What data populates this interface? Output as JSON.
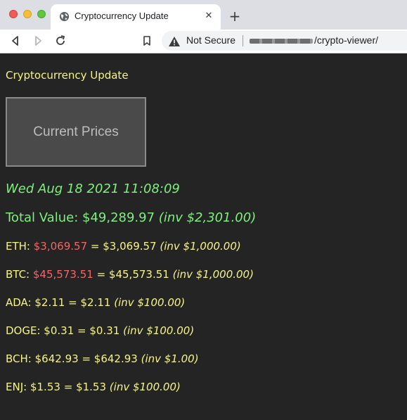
{
  "browser": {
    "tab_title": "Cryptocurrency Update",
    "address_security": "Not Secure",
    "address_path": "/crypto-viewer/"
  },
  "page": {
    "heading": "Cryptocurrency Update",
    "button_label": "Current Prices",
    "timestamp": "Wed Aug 18 2021 11:08:09",
    "total_label": "Total Value:",
    "total_value": "$49,289.97",
    "total_invested": "(inv $2,301.00)",
    "coins": [
      {
        "symbol": "ETH:",
        "price": "$3,069.57",
        "price_style": "red",
        "equals": "=",
        "value": "$3,069.57",
        "invested": "(inv $1,000.00)"
      },
      {
        "symbol": "BTC:",
        "price": "$45,573.51",
        "price_style": "red",
        "equals": "=",
        "value": "$45,573.51",
        "invested": "(inv $1,000.00)"
      },
      {
        "symbol": "ADA:",
        "price": "$2.11",
        "price_style": "normal",
        "equals": "=",
        "value": "$2.11",
        "invested": "(inv $100.00)"
      },
      {
        "symbol": "DOGE:",
        "price": "$0.31",
        "price_style": "normal",
        "equals": "=",
        "value": "$0.31",
        "invested": "(inv $100.00)"
      },
      {
        "symbol": "BCH:",
        "price": "$642.93",
        "price_style": "normal",
        "equals": "=",
        "value": "$642.93",
        "invested": "(inv $1.00)"
      },
      {
        "symbol": "ENJ:",
        "price": "$1.53",
        "price_style": "normal",
        "equals": "=",
        "value": "$1.53",
        "invested": "(inv $100.00)"
      }
    ]
  },
  "colors": {
    "background": "#242424",
    "text_yellow": "#f5f587",
    "text_green": "#7df07d",
    "price_red": "#f06868",
    "button_bg": "#4a4a4a"
  },
  "icons": [
    "globe-icon",
    "close-icon",
    "plus-icon",
    "back-icon",
    "forward-icon",
    "reload-icon",
    "bookmark-icon",
    "warning-icon"
  ]
}
